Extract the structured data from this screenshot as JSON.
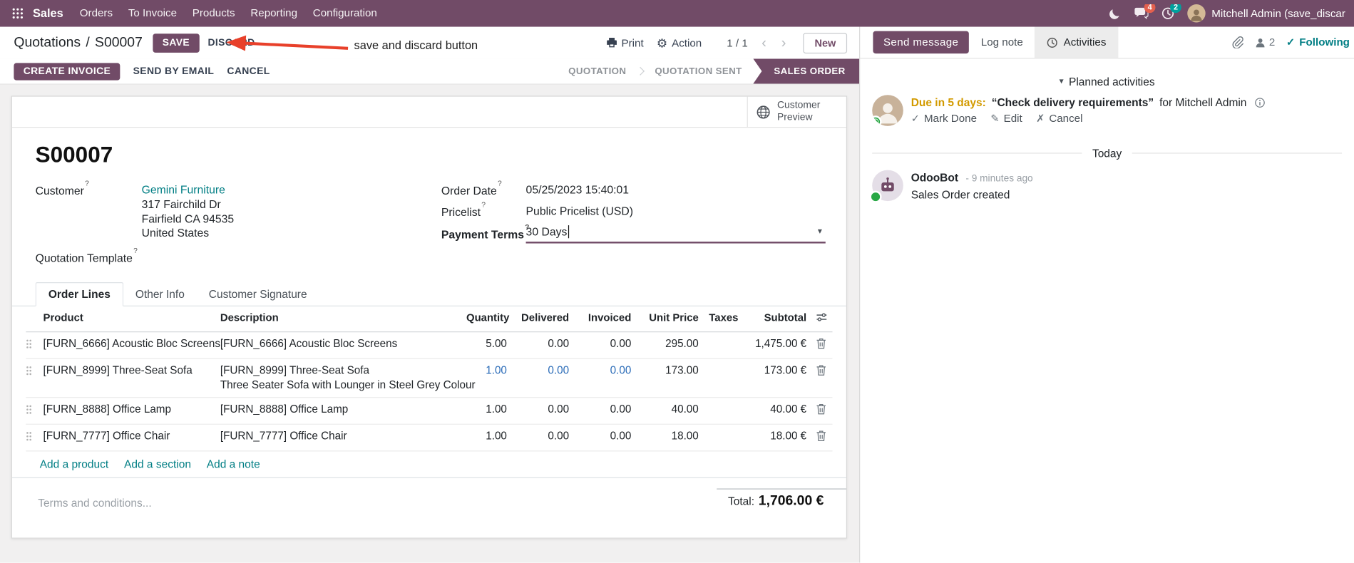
{
  "colors": {
    "primary": "#714B67",
    "link": "#017e84",
    "edited_value": "#2b6cb8",
    "activity_due_warning": "#d29a00",
    "annotation_red": "#e8402a"
  },
  "icons": {
    "gear": "⚙",
    "chevron_left": "‹",
    "chevron_right": "›",
    "caret_down": "▾",
    "check": "✓",
    "pencil": "✎",
    "cross": "✗"
  },
  "topbar": {
    "brand": "Sales",
    "menus": [
      {
        "label": "Orders"
      },
      {
        "label": "To Invoice"
      },
      {
        "label": "Products"
      },
      {
        "label": "Reporting"
      },
      {
        "label": "Configuration"
      }
    ],
    "messages_badge": "4",
    "activities_badge": "2",
    "user_name": "Mitchell Admin (save_discar"
  },
  "annotation": {
    "text": "save and discard button"
  },
  "breadcrumb": {
    "parent": "Quotations",
    "separator": "/",
    "current": "S00007"
  },
  "control_panel": {
    "save": "SAVE",
    "discard": "DISCARD",
    "print": "Print",
    "action": "Action",
    "pager": "1 / 1",
    "new": "New"
  },
  "statusbar": {
    "create_invoice": "CREATE INVOICE",
    "send_by_email": "SEND BY EMAIL",
    "cancel": "CANCEL",
    "stages": [
      {
        "label": "QUOTATION"
      },
      {
        "label": "QUOTATION SENT"
      },
      {
        "label": "SALES ORDER"
      }
    ]
  },
  "form": {
    "help_marker": "?",
    "customer_preview": "Customer Preview",
    "title": "S00007",
    "customer": {
      "label": "Customer",
      "name": "Gemini Furniture",
      "address_line1": "317 Fairchild Dr",
      "address_line2": "Fairfield CA 94535",
      "address_line3": "United States"
    },
    "quotation_template_label": "Quotation Template",
    "order_date": {
      "label": "Order Date",
      "value": "05/25/2023 15:40:01"
    },
    "pricelist": {
      "label": "Pricelist",
      "value": "Public Pricelist (USD)"
    },
    "payment_terms": {
      "label": "Payment Terms",
      "value": "30 Days"
    },
    "tabs": [
      {
        "label": "Order Lines"
      },
      {
        "label": "Other Info"
      },
      {
        "label": "Customer Signature"
      }
    ],
    "order_lines": {
      "headers": {
        "product": "Product",
        "description": "Description",
        "quantity": "Quantity",
        "delivered": "Delivered",
        "invoiced": "Invoiced",
        "unit_price": "Unit Price",
        "taxes": "Taxes",
        "subtotal": "Subtotal"
      },
      "rows": [
        {
          "product": "[FURN_6666] Acoustic Bloc Screens",
          "description": "[FURN_6666] Acoustic Bloc Screens",
          "description_line2": "",
          "quantity": "5.00",
          "delivered": "0.00",
          "invoiced": "0.00",
          "unit_price": "295.00",
          "subtotal": "1,475.00 €"
        },
        {
          "product": "[FURN_8999] Three-Seat Sofa",
          "description": "[FURN_8999] Three-Seat Sofa",
          "description_line2": "Three Seater Sofa with Lounger in Steel Grey Colour",
          "quantity": "1.00",
          "delivered": "0.00",
          "invoiced": "0.00",
          "unit_price": "173.00",
          "subtotal": "173.00 €"
        },
        {
          "product": "[FURN_8888] Office Lamp",
          "description": "[FURN_8888] Office Lamp",
          "description_line2": "",
          "quantity": "1.00",
          "delivered": "0.00",
          "invoiced": "0.00",
          "unit_price": "40.00",
          "subtotal": "40.00 €"
        },
        {
          "product": "[FURN_7777] Office Chair",
          "description": "[FURN_7777] Office Chair",
          "description_line2": "",
          "quantity": "1.00",
          "delivered": "0.00",
          "invoiced": "0.00",
          "unit_price": "18.00",
          "subtotal": "18.00 €"
        }
      ],
      "add_product": "Add a product",
      "add_section": "Add a section",
      "add_note": "Add a note"
    },
    "terms_placeholder": "Terms and conditions...",
    "total_label": "Total:",
    "total_value": "1,706.00 €"
  },
  "chatter": {
    "send_message": "Send message",
    "log_note": "Log note",
    "activities_tab": "Activities",
    "followers_count": "2",
    "following": "Following",
    "planned_activities": "Planned activities",
    "activity": {
      "due": "Due in 5 days:",
      "summary": "“Check delivery requirements”",
      "assignee": "for Mitchell Admin",
      "mark_done": "Mark Done",
      "edit": "Edit",
      "cancel": "Cancel"
    },
    "date_divider": "Today",
    "message": {
      "author": "OdooBot",
      "time": "- 9 minutes ago",
      "body": "Sales Order created"
    }
  }
}
